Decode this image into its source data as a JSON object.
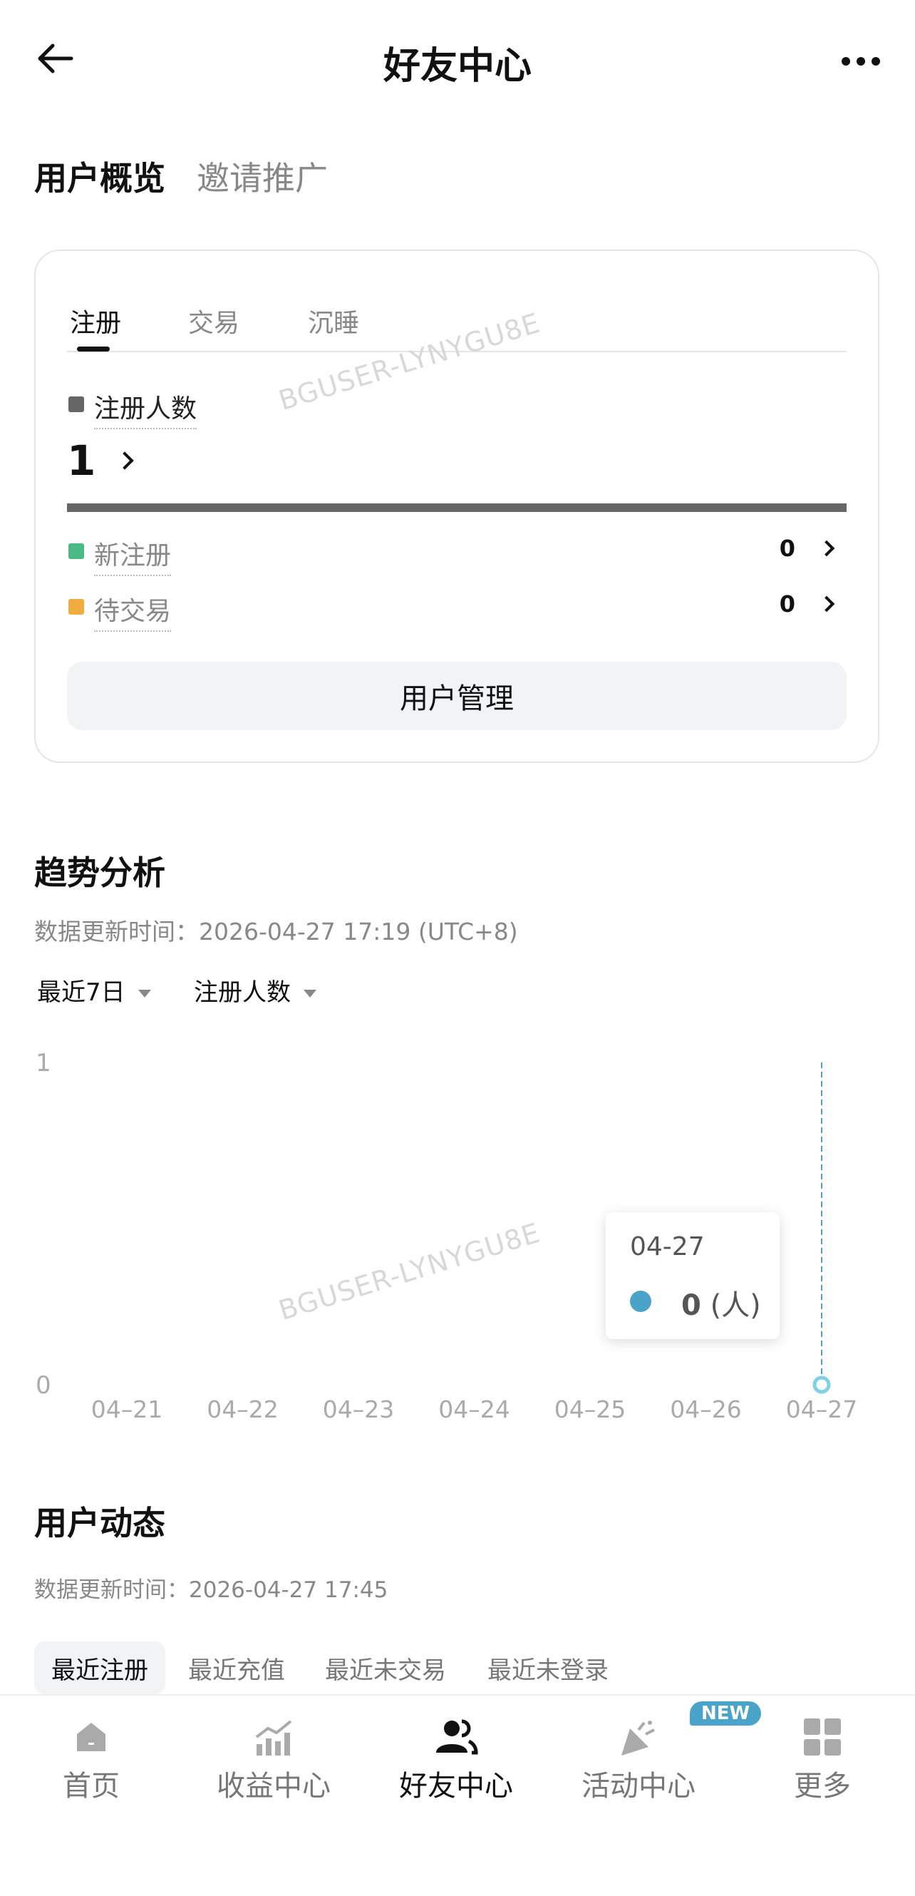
{
  "header": {
    "title": "好友中心"
  },
  "section_tabs": [
    "用户概览",
    "邀请推广"
  ],
  "overview": {
    "tabs": [
      "注册",
      "交易",
      "沉睡"
    ],
    "metric_label": "注册人数",
    "metric_value": "1",
    "rows": [
      {
        "label": "新注册",
        "value": "0",
        "color": "#4cba85"
      },
      {
        "label": "待交易",
        "value": "0",
        "color": "#f0ac3d"
      }
    ],
    "manage_button": "用户管理"
  },
  "watermark": "BGUSER-LYNYGU8E",
  "trend": {
    "title": "趋势分析",
    "update_time": "数据更新时间：2026-04-27 17:19 (UTC+8)",
    "filters": [
      "最近7日",
      "注册人数"
    ]
  },
  "chart_data": {
    "type": "line",
    "x": [
      "04–21",
      "04–22",
      "04–23",
      "04–24",
      "04–25",
      "04–26",
      "04–27"
    ],
    "series": [
      {
        "values": [
          0,
          0,
          0,
          0,
          0,
          0,
          0
        ]
      }
    ],
    "y_ticks": [
      "1",
      "0"
    ],
    "ylim": [
      0,
      1
    ],
    "tooltip": {
      "date": "04-27",
      "value": "0",
      "unit": "(人)"
    },
    "accent": "#4aa3c9"
  },
  "activity": {
    "title": "用户动态",
    "update_time": "数据更新时间：2026-04-27 17:45",
    "tabs": [
      "最近注册",
      "最近充值",
      "最近未交易",
      "最近未登录"
    ]
  },
  "bottom_nav": {
    "items": [
      {
        "label": "首页",
        "icon": "home-icon"
      },
      {
        "label": "收益中心",
        "icon": "earnings-chart-icon"
      },
      {
        "label": "好友中心",
        "icon": "friends-icon"
      },
      {
        "label": "活动中心",
        "icon": "party-popper-icon"
      },
      {
        "label": "更多",
        "icon": "grid-icon"
      }
    ],
    "new_badge": "NEW"
  }
}
